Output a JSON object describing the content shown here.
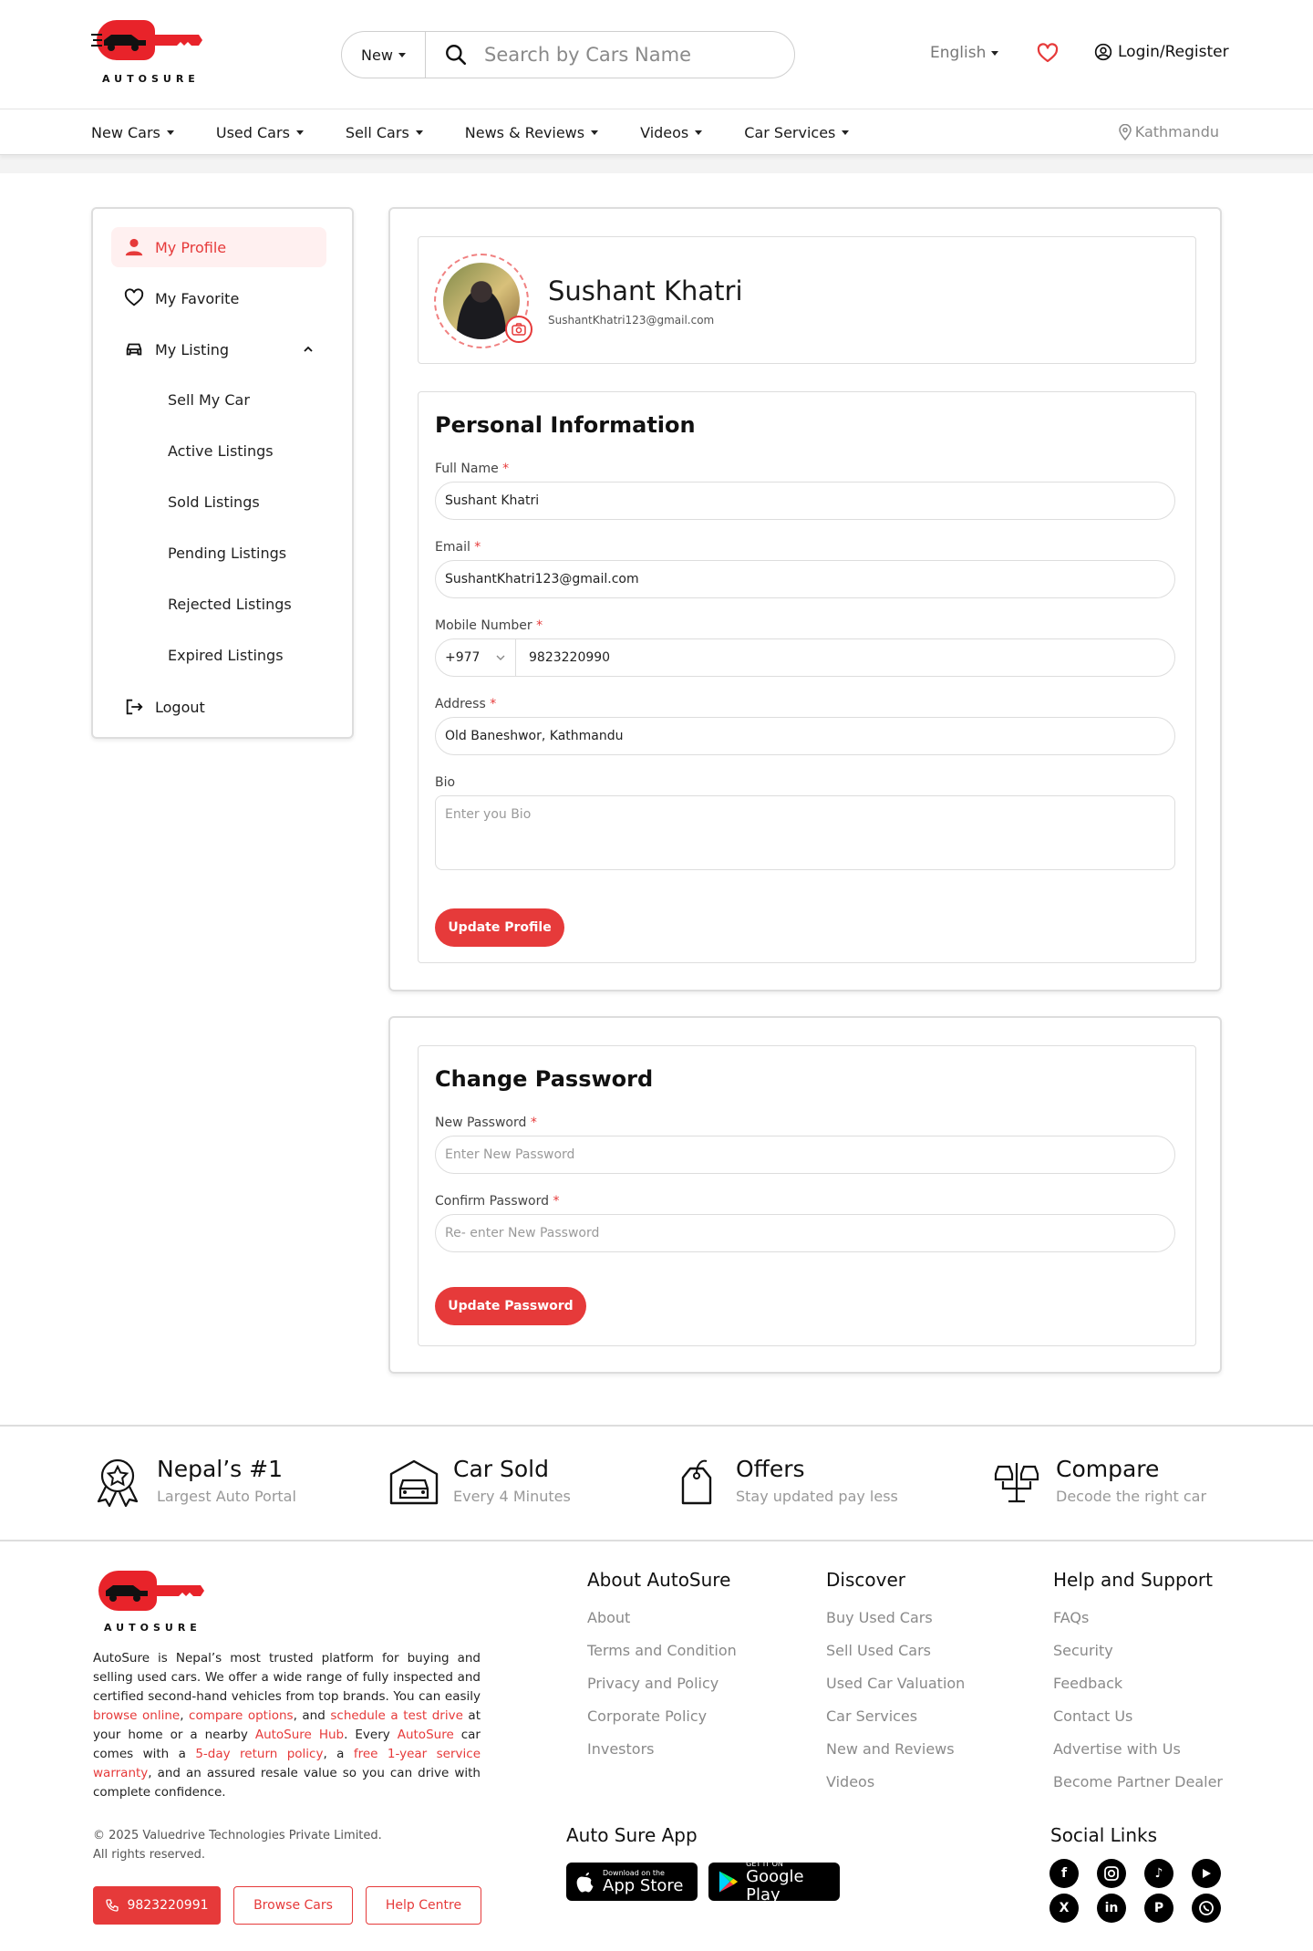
{
  "brand": {
    "word": "AUTOSURE"
  },
  "header": {
    "search_filter": "New",
    "search_placeholder": "Search by Cars Name",
    "language": "English",
    "login": "Login/Register"
  },
  "nav": {
    "items": [
      "New Cars",
      "Used Cars",
      "Sell Cars",
      "News & Reviews",
      "Videos",
      "Car Services"
    ],
    "location": "Kathmandu"
  },
  "sidebar": {
    "my_profile": "My Profile",
    "my_favorite": "My Favorite",
    "my_listing": "My Listing",
    "sub": [
      "Sell My Car",
      "Active Listings",
      "Sold Listings",
      "Pending Listings",
      "Rejected Listings",
      "Expired Listings"
    ],
    "logout": "Logout"
  },
  "profile": {
    "name": "Sushant Khatri",
    "email": "SushantKhatri123@gmail.com"
  },
  "personal": {
    "title": "Personal Information",
    "full_name_label": "Full Name",
    "full_name": "Sushant Khatri",
    "email_label": "Email",
    "email": "SushantKhatri123@gmail.com",
    "mobile_label": "Mobile Number",
    "country_code": "+977",
    "mobile": "9823220990",
    "address_label": "Address",
    "address": "Old Baneshwor, Kathmandu",
    "bio_label": "Bio",
    "bio_placeholder": "Enter you Bio",
    "required": "*",
    "button": "Update Profile"
  },
  "password": {
    "title": "Change Password",
    "new_label": "New Password",
    "new_placeholder": "Enter New Password",
    "confirm_label": "Confirm Password",
    "confirm_placeholder": "Re- enter New Password",
    "button": "Update Password"
  },
  "features": [
    {
      "title": "Nepal’s #1",
      "sub": "Largest Auto Portal"
    },
    {
      "title": "Car Sold",
      "sub": "Every 4 Minutes"
    },
    {
      "title": "Offers",
      "sub": "Stay updated pay less"
    },
    {
      "title": "Compare",
      "sub": "Decode the right car"
    }
  ],
  "footer": {
    "about": {
      "p1": "AutoSure is Nepal’s most trusted platform for buying and selling used cars. We offer a wide range of fully inspected and certified second-hand vehicles from top brands. You can easily ",
      "l1": "browse online",
      "p2": ", ",
      "l2": "compare options",
      "p3": ", and ",
      "l3": "schedule a test drive",
      "p4": " at your home or a nearby ",
      "l4": "AutoSure Hub",
      "p5": ". Every ",
      "l5": "AutoSure",
      "p6": " car comes with a ",
      "l6": "5-day return policy",
      "p7": ", a ",
      "l7": "free 1-year service warranty",
      "p8": ", and an assured resale value so you can drive with complete confidence."
    },
    "copyright1": "© 2025 Valuedrive Technologies Private Limited.",
    "copyright2": "All rights reserved.",
    "phone": "9823220991",
    "browse": "Browse Cars",
    "help": "Help Centre",
    "col1_title": "About AutoSure",
    "col1": [
      "About",
      "Terms and Condition",
      "Privacy and Policy",
      "Corporate Policy",
      "Investors"
    ],
    "col2_title": "Discover",
    "col2": [
      "Buy Used Cars",
      "Sell Used Cars",
      "Used Car Valuation",
      "Car Services",
      "New and Reviews",
      "Videos"
    ],
    "col3_title": "Help and Support",
    "col3": [
      "FAQs",
      "Security",
      "Feedback",
      "Contact Us",
      "Advertise with Us",
      "Become Partner Dealer"
    ],
    "app_title": "Auto Sure App",
    "appstore_small": "Download on the",
    "appstore_big": "App Store",
    "gplay_small": "GET IT ON",
    "gplay_big": "Google Play",
    "social_title": "Social Links"
  },
  "colors": {
    "accent": "#e63a3a"
  }
}
